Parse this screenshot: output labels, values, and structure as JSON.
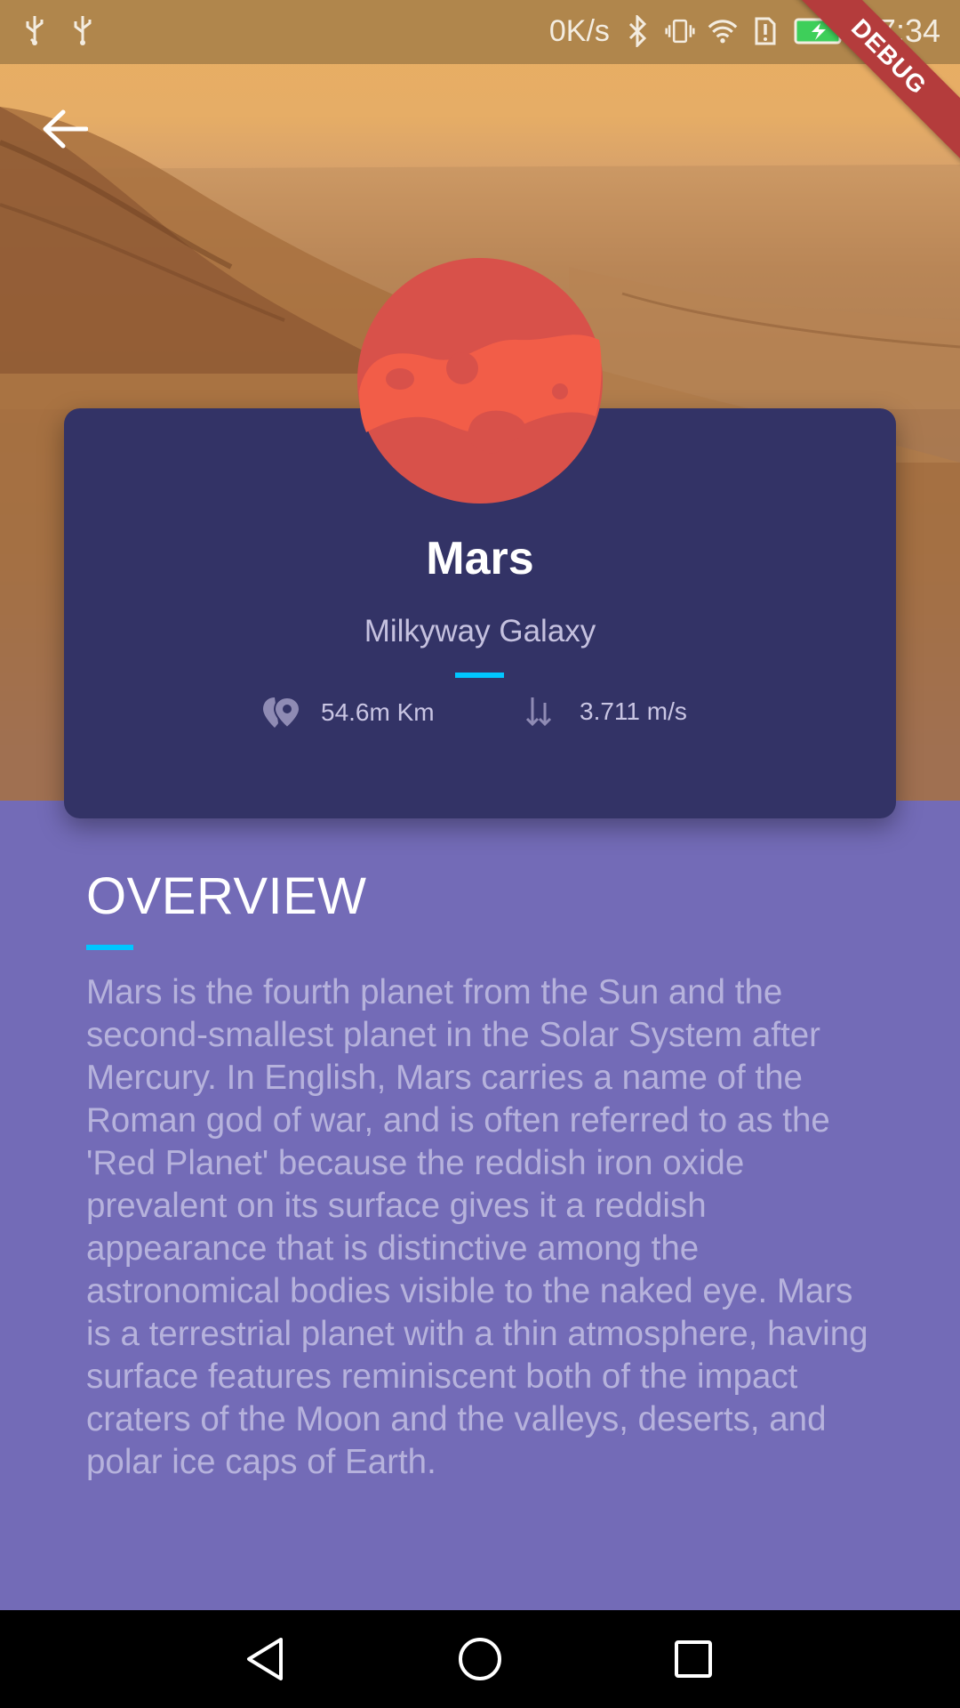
{
  "status_bar": {
    "network_speed": "0K/s",
    "time": "17:34",
    "icons": [
      "usb-icon",
      "usb-icon",
      "bluetooth-icon",
      "vibrate-icon",
      "wifi-icon",
      "sim-alert-icon",
      "battery-charging-icon"
    ]
  },
  "debug_banner": {
    "label": "DEBUG"
  },
  "planet": {
    "name": "Mars",
    "location": "Milkyway Galaxy",
    "distance": "54.6m Km",
    "gravity": "3.711 m/s"
  },
  "overview": {
    "title": "OVERVIEW",
    "text": "Mars is the fourth planet from the Sun and the second-smallest planet in the Solar System after Mercury. In English, Mars carries a name of the Roman god of war, and is often referred to as the 'Red Planet' because the reddish iron oxide prevalent on its surface gives it a reddish appearance that is distinctive among the astronomical bodies visible to the naked eye. Mars is a terrestrial planet with a thin atmosphere, having surface features reminiscent both of the impact craters of the Moon and the valleys, deserts, and polar ice caps of Earth."
  },
  "colors": {
    "accent": "#00c6ff",
    "card": "#333366",
    "page_background": "#736bb7",
    "planet_red": "#f25d48"
  }
}
